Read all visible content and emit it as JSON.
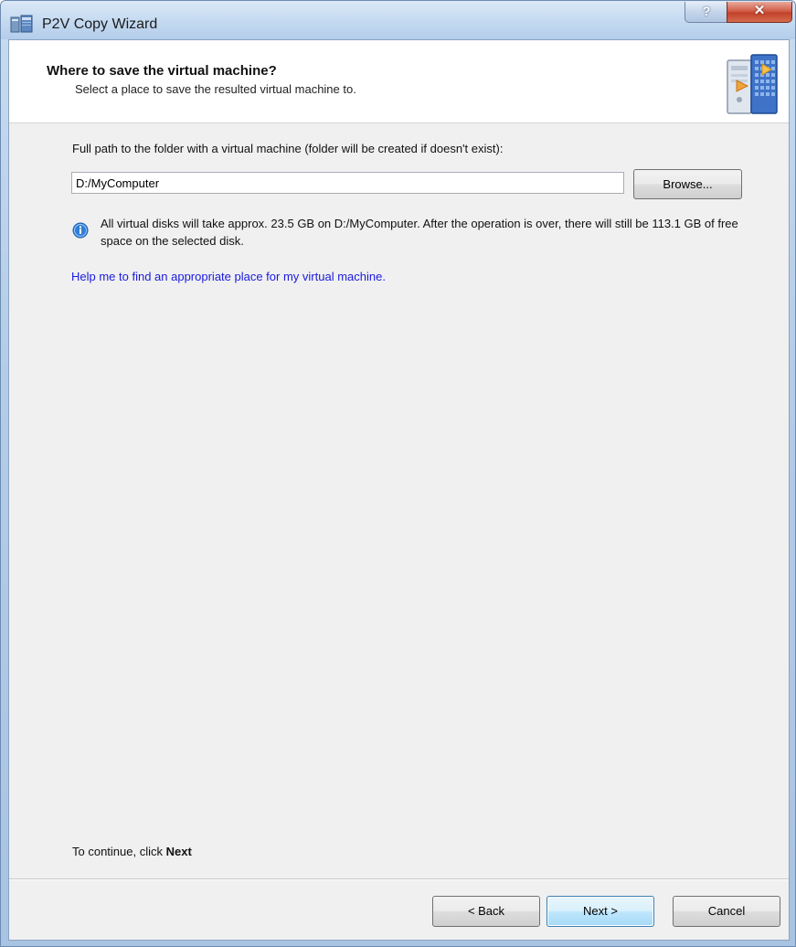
{
  "window": {
    "title": "P2V Copy Wizard",
    "help_label": "?",
    "close_label": "✕"
  },
  "header": {
    "title": "Where to save the virtual machine?",
    "subtitle": "Select a place to save the resulted virtual machine to."
  },
  "path": {
    "label": "Full path to the folder with a virtual machine (folder will be created if doesn't exist):",
    "value": "D:/MyComputer",
    "browse_label": "Browse..."
  },
  "info": {
    "icon": "info-icon",
    "text": "All virtual disks will take approx. 23.5 GB on D:/MyComputer. After the operation is over, there will still be 113.1 GB of free space on the selected disk."
  },
  "help_link": "Help me to find an appropriate place for my virtual machine.",
  "footer": {
    "continue_prefix": "To continue, click ",
    "continue_bold": "Next",
    "back_label": "< Back",
    "next_label": "Next >",
    "cancel_label": "Cancel"
  },
  "colors": {
    "link": "#1a1ae0",
    "close": "#c2412b",
    "info": "#2f7fd8"
  }
}
